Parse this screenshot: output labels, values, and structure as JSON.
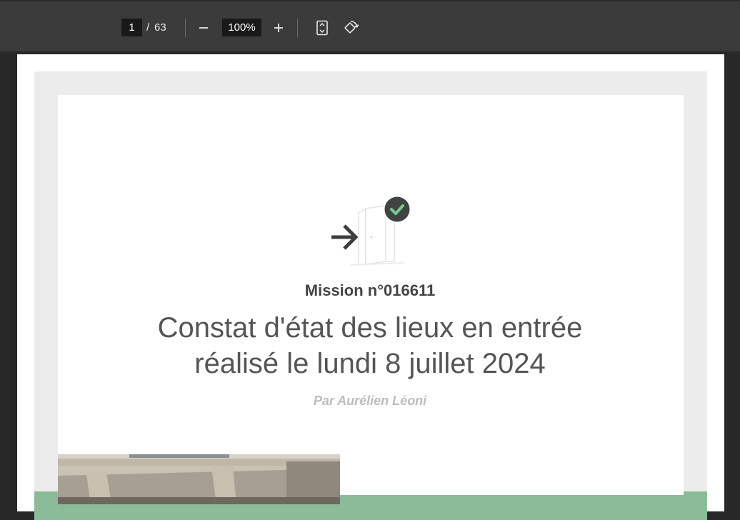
{
  "toolbar": {
    "current_page": "1",
    "separator": "/",
    "total_pages": "63",
    "zoom": "100%",
    "zoom_out_icon": "minus-icon",
    "zoom_in_icon": "plus-icon",
    "fit_icon": "fit-page-icon",
    "rotate_icon": "rotate-icon"
  },
  "document": {
    "mission": "Mission n°016611",
    "title_line1": "Constat d'état des lieux en entrée",
    "title_line2": "réalisé le lundi 8 juillet 2024",
    "author": "Par Aurélien Léoni",
    "entry_icon": "door-entry-icon",
    "check_icon": "check-icon",
    "photo_icon": "building-photo"
  },
  "colors": {
    "accent_green": "#8bbb99",
    "badge": "#3f4443",
    "check": "#7cc98f"
  }
}
